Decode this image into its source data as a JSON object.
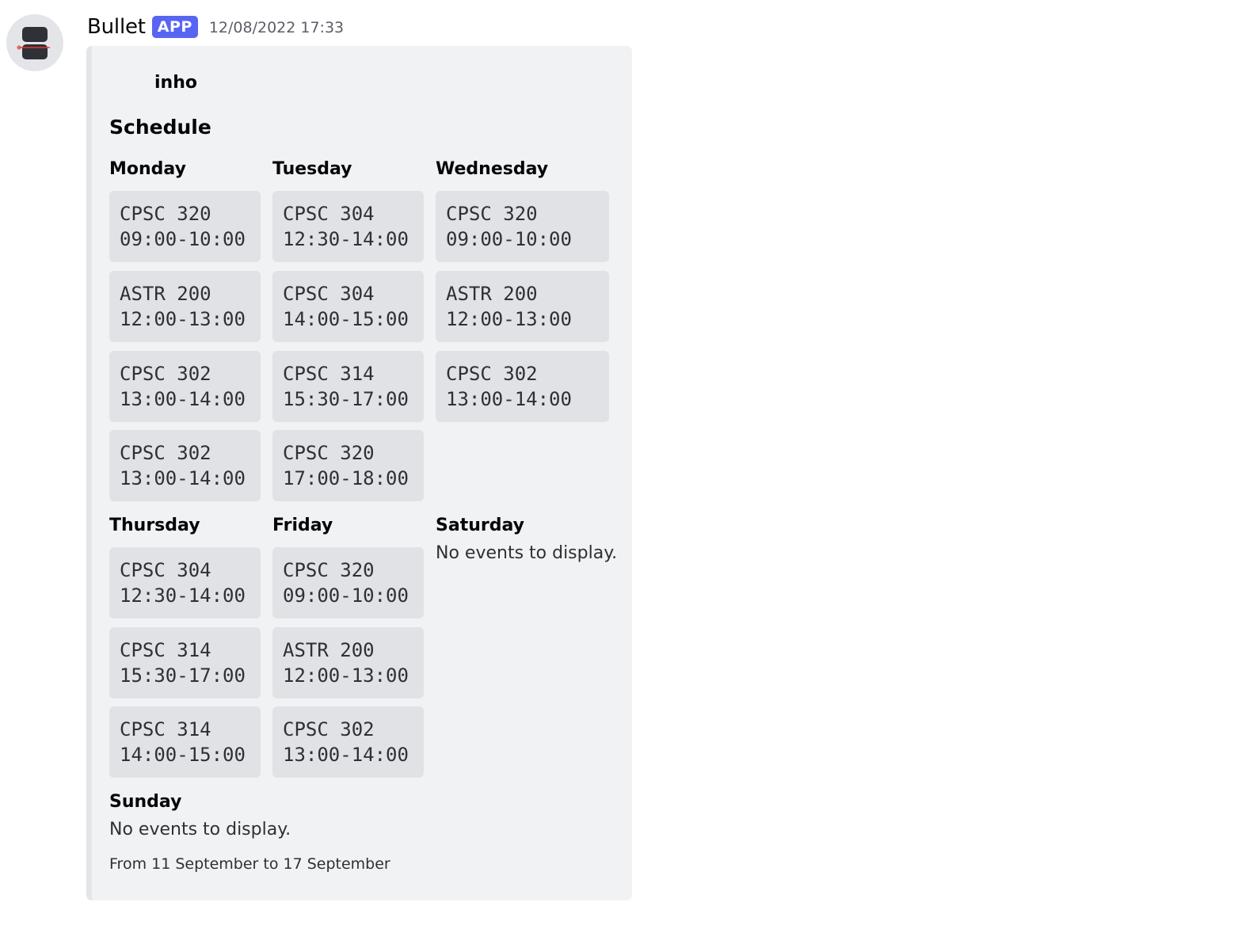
{
  "message": {
    "username": "Bullet",
    "badge": "APP",
    "timestamp": "12/08/2022 17:33"
  },
  "embed": {
    "author": "inho",
    "title": "Schedule",
    "days": [
      {
        "name": "Monday",
        "events": [
          {
            "course": "CPSC 320",
            "time": "09:00-10:00"
          },
          {
            "course": "ASTR 200",
            "time": "12:00-13:00"
          },
          {
            "course": "CPSC 302",
            "time": "13:00-14:00"
          },
          {
            "course": "CPSC 302",
            "time": "13:00-14:00"
          }
        ]
      },
      {
        "name": "Tuesday",
        "events": [
          {
            "course": "CPSC 304",
            "time": "12:30-14:00"
          },
          {
            "course": "CPSC 304",
            "time": "14:00-15:00"
          },
          {
            "course": "CPSC 314",
            "time": "15:30-17:00"
          },
          {
            "course": "CPSC 320",
            "time": "17:00-18:00"
          }
        ]
      },
      {
        "name": "Wednesday",
        "events": [
          {
            "course": "CPSC 320",
            "time": "09:00-10:00"
          },
          {
            "course": "ASTR 200",
            "time": "12:00-13:00"
          },
          {
            "course": "CPSC 302",
            "time": "13:00-14:00"
          }
        ]
      },
      {
        "name": "Thursday",
        "events": [
          {
            "course": "CPSC 304",
            "time": "12:30-14:00"
          },
          {
            "course": "CPSC 314",
            "time": "15:30-17:00"
          },
          {
            "course": "CPSC 314",
            "time": "14:00-15:00"
          }
        ]
      },
      {
        "name": "Friday",
        "events": [
          {
            "course": "CPSC 320",
            "time": "09:00-10:00"
          },
          {
            "course": "ASTR 200",
            "time": "12:00-13:00"
          },
          {
            "course": "CPSC 302",
            "time": "13:00-14:00"
          }
        ]
      },
      {
        "name": "Saturday",
        "events": [],
        "empty_text": "No events to display."
      },
      {
        "name": "Sunday",
        "events": [],
        "empty_text": "No events to display."
      }
    ],
    "footer": "From 11 September to 17 September"
  }
}
